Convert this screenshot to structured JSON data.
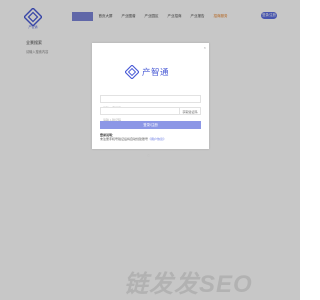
{
  "header": {
    "logo_text": "产智通",
    "nav": [
      {
        "label": "",
        "state": "active"
      },
      {
        "label": "首页大屏"
      },
      {
        "label": "产业图谱"
      },
      {
        "label": "产业园区"
      },
      {
        "label": "产业招商"
      },
      {
        "label": "产业报告"
      },
      {
        "label": "招商服务",
        "state": "highlight"
      }
    ],
    "login_label": "登录/注册"
  },
  "page": {
    "title": "全景搜索",
    "subtitle": "请输入搜索内容"
  },
  "modal": {
    "close": "×",
    "brand": "产智通",
    "phone_placeholder": "请输入手机号",
    "code_placeholder": "请输入验证码",
    "code_button": "获取验证码",
    "submit_label": "登录/注册",
    "tip_title": "登录说明：",
    "tip_text": "未注册手机号验证后将自动创建账号",
    "tip_link": "《用户协议》"
  },
  "watermark": "链发发SEO",
  "colors": {
    "brand": "#4a5bd6",
    "submit": "#8c97e6",
    "nav_active": "#7b84d8",
    "highlight": "#e67e22"
  }
}
